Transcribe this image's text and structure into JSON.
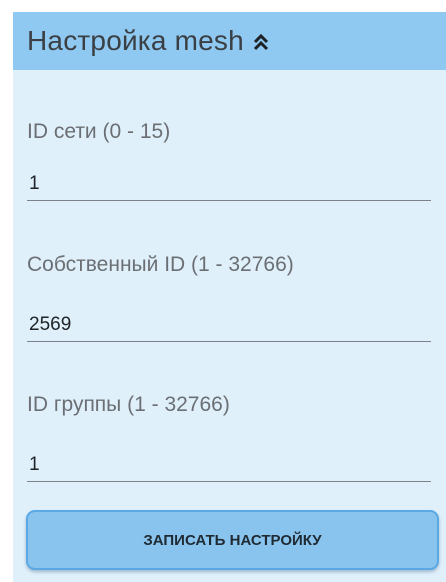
{
  "header": {
    "title": "Настройка mesh",
    "toggle_icon": "double-chevron-up-icon"
  },
  "fields": [
    {
      "label": "ID сети (0 - 15)",
      "value": "1"
    },
    {
      "label": "Собственный ID (1 - 32766)",
      "value": "2569"
    },
    {
      "label": "ID группы (1 - 32766)",
      "value": "1"
    }
  ],
  "actions": {
    "save_label": "ЗАПИСАТЬ НАСТРОЙКУ"
  },
  "colors": {
    "panel_background": "#dff0fb",
    "header_background": "#8fc8f0",
    "button_background": "#88c4ee",
    "button_border": "#5aa8e4"
  }
}
